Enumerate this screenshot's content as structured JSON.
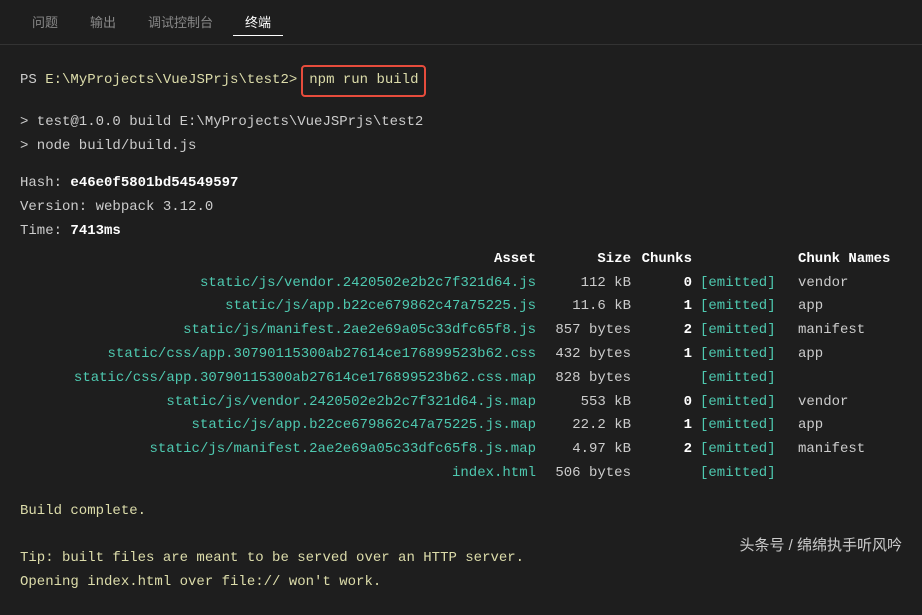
{
  "tabs": {
    "problems": "问题",
    "output": "输出",
    "debug_console": "调试控制台",
    "terminal": "终端"
  },
  "prompt": {
    "ps": "PS ",
    "path": "E:\\MyProjects\\VueJSPrjs\\test2>",
    "command": "npm run build"
  },
  "exec": {
    "line1": "> test@1.0.0 build E:\\MyProjects\\VueJSPrjs\\test2",
    "line2": "> node build/build.js"
  },
  "stats": {
    "hash_label": "Hash: ",
    "hash_value": "e46e0f5801bd54549597",
    "version_label": "Version: ",
    "version_value": "webpack 3.12.0",
    "time_label": "Time: ",
    "time_value": "7413ms"
  },
  "table": {
    "headers": {
      "asset": "Asset",
      "size": "Size",
      "chunks": "Chunks",
      "emitted": "",
      "names": "Chunk Names"
    },
    "rows": [
      {
        "asset": "static/js/vendor.2420502e2b2c7f321d64.js",
        "size": "112 kB",
        "chunks": "0",
        "emitted": "[emitted]",
        "names": "vendor"
      },
      {
        "asset": "static/js/app.b22ce679862c47a75225.js",
        "size": "11.6 kB",
        "chunks": "1",
        "emitted": "[emitted]",
        "names": "app"
      },
      {
        "asset": "static/js/manifest.2ae2e69a05c33dfc65f8.js",
        "size": "857 bytes",
        "chunks": "2",
        "emitted": "[emitted]",
        "names": "manifest"
      },
      {
        "asset": "static/css/app.30790115300ab27614ce176899523b62.css",
        "size": "432 bytes",
        "chunks": "1",
        "emitted": "[emitted]",
        "names": "app"
      },
      {
        "asset": "static/css/app.30790115300ab27614ce176899523b62.css.map",
        "size": "828 bytes",
        "chunks": "",
        "emitted": "[emitted]",
        "names": ""
      },
      {
        "asset": "static/js/vendor.2420502e2b2c7f321d64.js.map",
        "size": "553 kB",
        "chunks": "0",
        "emitted": "[emitted]",
        "names": "vendor"
      },
      {
        "asset": "static/js/app.b22ce679862c47a75225.js.map",
        "size": "22.2 kB",
        "chunks": "1",
        "emitted": "[emitted]",
        "names": "app"
      },
      {
        "asset": "static/js/manifest.2ae2e69a05c33dfc65f8.js.map",
        "size": "4.97 kB",
        "chunks": "2",
        "emitted": "[emitted]",
        "names": "manifest"
      },
      {
        "asset": "index.html",
        "size": "506 bytes",
        "chunks": "",
        "emitted": "[emitted]",
        "names": ""
      }
    ]
  },
  "footer": {
    "complete": " Build complete.",
    "tip1": " Tip: built files are meant to be served over an HTTP server.",
    "tip2": " Opening index.html over file:// won't work."
  },
  "watermark": "头条号 / 绵绵执手听风吟"
}
